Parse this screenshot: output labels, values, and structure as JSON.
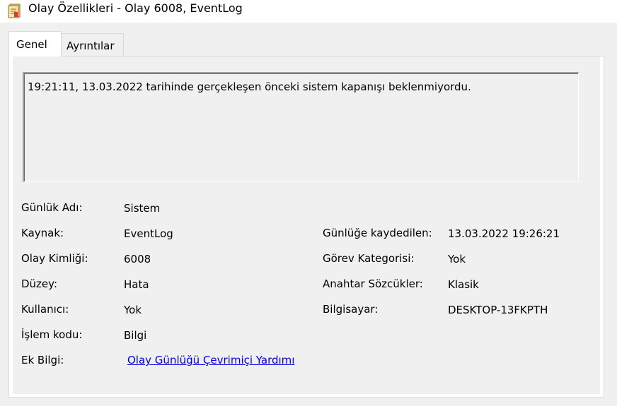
{
  "window": {
    "title": "Olay Özellikleri - Olay 6008, EventLog"
  },
  "tabs": [
    {
      "label": "Genel"
    },
    {
      "label": "Ayrıntılar"
    }
  ],
  "description": "19:21:11, 13.03.2022 tarihinde gerçekleşen önceki sistem kapanışı beklenmiyordu.",
  "fields": {
    "log_name": {
      "label": "Günlük Adı:",
      "value": "Sistem"
    },
    "source": {
      "label": "Kaynak:",
      "value": "EventLog"
    },
    "event_id": {
      "label": "Olay Kimliği:",
      "value": "6008"
    },
    "level": {
      "label": "Düzey:",
      "value": "Hata"
    },
    "user": {
      "label": "Kullanıcı:",
      "value": "Yok"
    },
    "opcode": {
      "label": "İşlem kodu:",
      "value": "Bilgi"
    },
    "more_info": {
      "label": "Ek Bilgi:",
      "link": "Olay Günlüğü Çevrimiçi Yardımı"
    },
    "logged": {
      "label": "Günlüğe kaydedilen:",
      "value": "13.03.2022 19:26:21"
    },
    "task_category": {
      "label": "Görev Kategorisi:",
      "value": "Yok"
    },
    "keywords": {
      "label": "Anahtar Sözcükler:",
      "value": "Klasik"
    },
    "computer": {
      "label": "Bilgisayar:",
      "value": "DESKTOP-13FKPTH"
    }
  }
}
